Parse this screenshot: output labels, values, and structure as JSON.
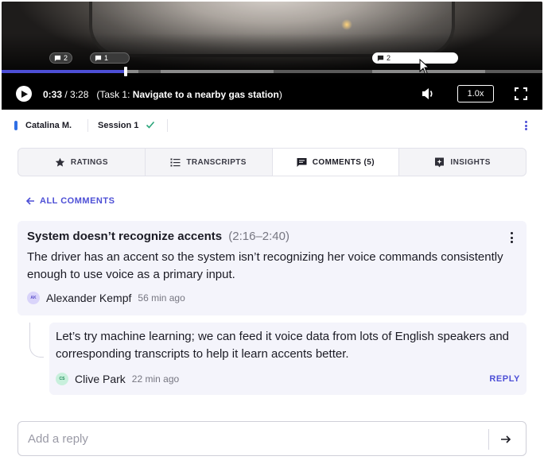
{
  "video": {
    "markers": [
      {
        "count": "2",
        "active": false
      },
      {
        "count": "1",
        "active": false
      },
      {
        "count": "2",
        "active": true
      }
    ],
    "progress_fraction": 0.23,
    "current_time": "0:33",
    "separator": " / ",
    "duration": "3:28",
    "task_prefix": "(Task 1: ",
    "task_name": "Navigate to a nearby gas station",
    "task_suffix": ")",
    "speed": "1.0x"
  },
  "session": {
    "participant": "Catalina M.",
    "session_label": "Session 1"
  },
  "tabs": [
    {
      "label": "RATINGS",
      "icon": "star-icon"
    },
    {
      "label": "TRANSCRIPTS",
      "icon": "list-icon"
    },
    {
      "label": "COMMENTS (5)",
      "icon": "comment-icon",
      "active": true
    },
    {
      "label": "INSIGHTS",
      "icon": "insight-icon"
    }
  ],
  "back_label": "ALL COMMENTS",
  "comment": {
    "title": "System doesn’t recognize accents",
    "range": "(2:16–2:40)",
    "body": "The driver has an accent so the system isn’t recognizing her voice commands consistently enough to use voice as a primary input.",
    "author": "Alexander Kempf",
    "initials": "AK",
    "avatar_color": "#d9d4fa",
    "time_ago": "56 min ago"
  },
  "reply_comment": {
    "body": "Let’s try machine learning; we can feed it voice data from lots of English speakers and corresponding transcripts to help it learn accents better.",
    "author": "Clive Park",
    "initials": "CS",
    "avatar_color": "#c8f0dc",
    "time_ago": "22 min ago",
    "reply_label": "REPLY"
  },
  "reply_input": {
    "placeholder": "Add a reply"
  },
  "colors": {
    "accent": "#4d4fd6",
    "participant_dot": "#2f6fe5",
    "check": "#2aa57a"
  }
}
